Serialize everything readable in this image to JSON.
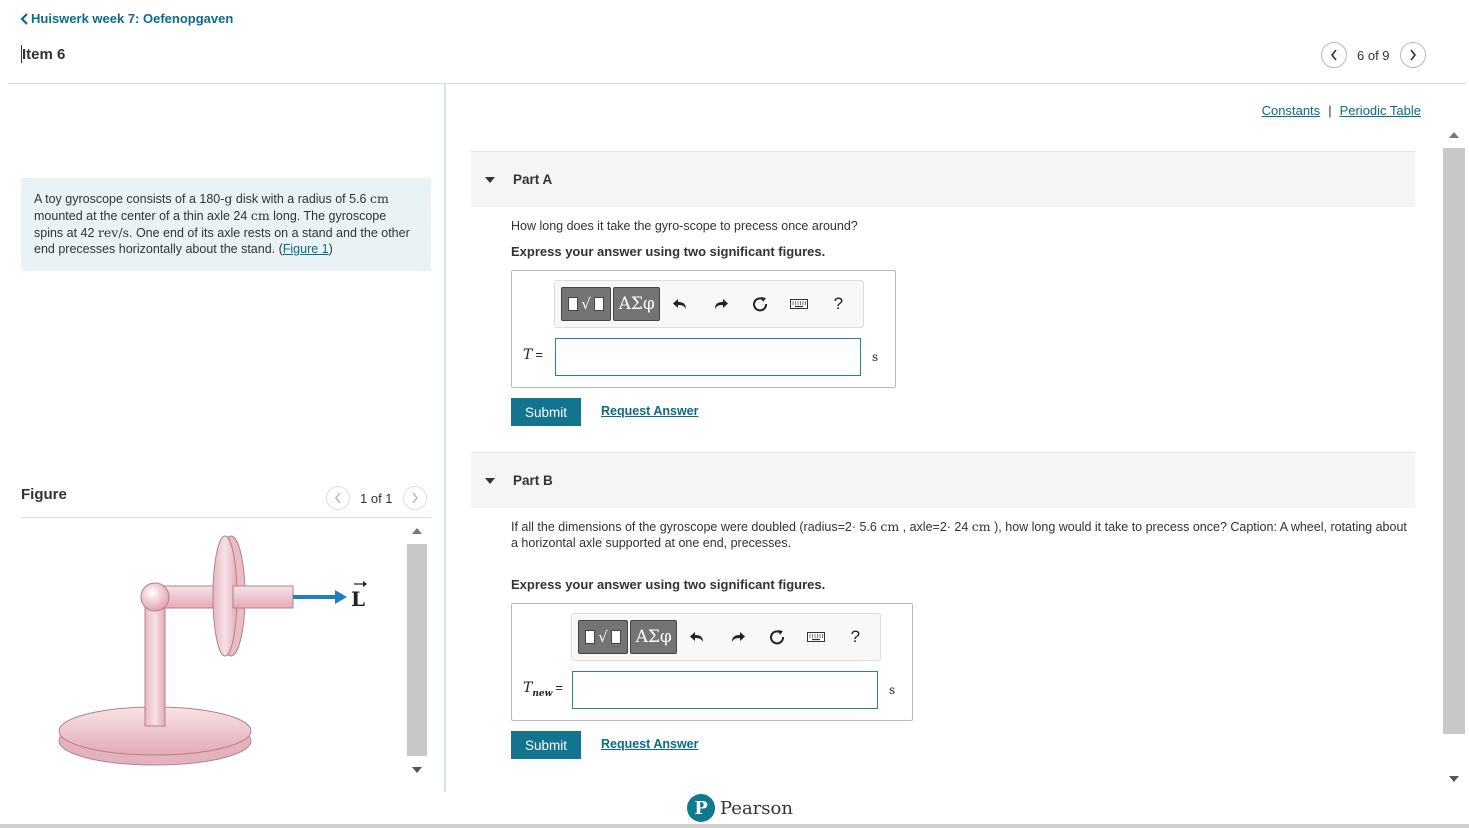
{
  "header": {
    "back_label": "Huiswerk week 7: Oefenopgaven",
    "item_title": "Item 6",
    "pager_text": "6 of 9"
  },
  "problem": {
    "text_1": "A toy gyroscope consists of a 180-",
    "unit_g": "g",
    "text_2": " disk with a radius of 5.6 ",
    "unit_cm": "cm",
    "text_3": " mounted at the center of a thin axle 24 ",
    "unit_cm2": "cm",
    "text_4": " long. The gyroscope spins at 42 ",
    "unit_revs": "rev/s",
    "text_5": ". One end of its axle rests on a stand and the other end precesses horizontally about the stand. (",
    "figure_link": "Figure 1",
    "text_6": ")"
  },
  "figure": {
    "label": "Figure",
    "pager_text": "1 of 1",
    "vector_label": "L"
  },
  "links": {
    "constants": "Constants",
    "separator": "|",
    "periodic_table": "Periodic Table"
  },
  "part_a": {
    "label": "Part A",
    "question": "How long does it take the gyro-scope to precess once around?",
    "instruction": "Express your answer using two significant figures.",
    "variable": "T",
    "equals": "=",
    "unit": "s",
    "input_value": "",
    "submit": "Submit",
    "request": "Request Answer"
  },
  "part_b": {
    "label": "Part B",
    "question_1": "If all the dimensions of the gyroscope were doubled (radius=2· 5.6 ",
    "unit_cm": "cm",
    "question_2": " , axle=2· 24 ",
    "unit_cm2": "cm",
    "question_3": " ), how long would it take to precess once? Caption: A wheel, rotating about a horizontal axle supported at one end, precesses.",
    "instruction": "Express your answer using two significant figures.",
    "variable": "T",
    "subscript": "new",
    "equals": "=",
    "unit": "s",
    "input_value": "",
    "submit": "Submit",
    "request": "Request Answer"
  },
  "toolbar": {
    "templates_symbol": "√",
    "greek_label": "ΑΣφ",
    "help_label": "?"
  },
  "footer": {
    "brand_initial": "P",
    "brand_name": "Pearson"
  },
  "colors": {
    "link": "#0b6b88",
    "submit_bg": "#12748f",
    "problem_bg": "#e9f3f6",
    "vector_arrow": "#1f7fc4"
  }
}
